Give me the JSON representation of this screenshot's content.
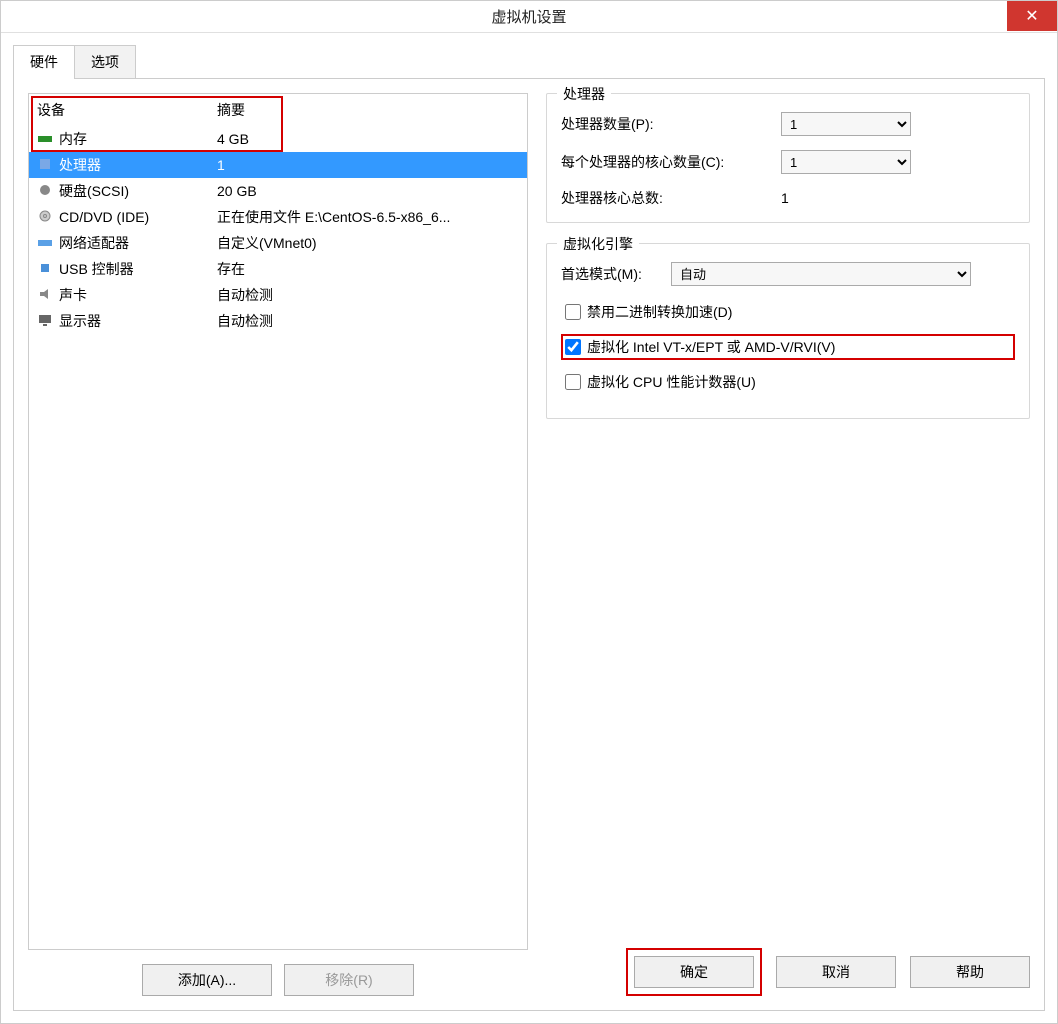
{
  "window": {
    "title": "虚拟机设置"
  },
  "tabs": {
    "hardware": "硬件",
    "options": "选项"
  },
  "device_list": {
    "header_device": "设备",
    "header_summary": "摘要",
    "items": [
      {
        "name": "内存",
        "summary": "4 GB",
        "icon": "memory-icon"
      },
      {
        "name": "处理器",
        "summary": "1",
        "icon": "cpu-icon",
        "selected": true
      },
      {
        "name": "硬盘(SCSI)",
        "summary": "20 GB",
        "icon": "hdd-icon"
      },
      {
        "name": "CD/DVD (IDE)",
        "summary": "正在使用文件 E:\\CentOS-6.5-x86_6...",
        "icon": "cd-icon"
      },
      {
        "name": "网络适配器",
        "summary": "自定义(VMnet0)",
        "icon": "network-icon"
      },
      {
        "name": "USB 控制器",
        "summary": "存在",
        "icon": "usb-icon"
      },
      {
        "name": "声卡",
        "summary": "自动检测",
        "icon": "sound-icon"
      },
      {
        "name": "显示器",
        "summary": "自动检测",
        "icon": "display-icon"
      }
    ]
  },
  "buttons": {
    "add": "添加(A)...",
    "remove": "移除(R)",
    "ok": "确定",
    "cancel": "取消",
    "help": "帮助"
  },
  "processor_group": {
    "title": "处理器",
    "num_processors_label": "处理器数量(P):",
    "num_processors_value": "1",
    "cores_per_label": "每个处理器的核心数量(C):",
    "cores_per_value": "1",
    "total_cores_label": "处理器核心总数:",
    "total_cores_value": "1"
  },
  "virt_group": {
    "title": "虚拟化引擎",
    "pref_mode_label": "首选模式(M):",
    "pref_mode_value": "自动",
    "chk_binary": "禁用二进制转换加速(D)",
    "chk_vtx": "虚拟化 Intel VT-x/EPT 或 AMD-V/RVI(V)",
    "chk_cpu_perf": "虚拟化 CPU 性能计数器(U)",
    "chk_binary_checked": false,
    "chk_vtx_checked": true,
    "chk_cpu_perf_checked": false
  },
  "colors": {
    "highlight": "#d40000",
    "selection": "#3399ff",
    "close": "#d0362f"
  }
}
